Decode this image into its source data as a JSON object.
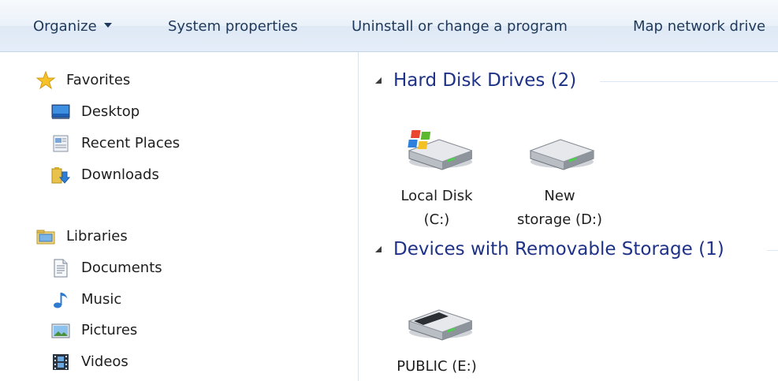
{
  "toolbar": {
    "organize": "Organize",
    "system_properties": "System properties",
    "uninstall": "Uninstall or change a program",
    "map_network_drive": "Map network drive"
  },
  "nav": {
    "favorites": "Favorites",
    "desktop": "Desktop",
    "recent_places": "Recent Places",
    "downloads": "Downloads",
    "libraries": "Libraries",
    "documents": "Documents",
    "music": "Music",
    "pictures": "Pictures",
    "videos": "Videos"
  },
  "groups": {
    "hard_disk": "Hard Disk Drives (2)",
    "removable": "Devices with Removable Storage (1)"
  },
  "drives": {
    "c_line1": "Local Disk",
    "c_line2": "(C:)",
    "d_line1": "New",
    "d_line2": "storage (D:)",
    "e_line1": "PUBLIC (E:)"
  },
  "colors": {
    "group_title": "#1e3287",
    "toolbar_text": "#1e395b",
    "toolbar_bg": "#e4edf8"
  }
}
